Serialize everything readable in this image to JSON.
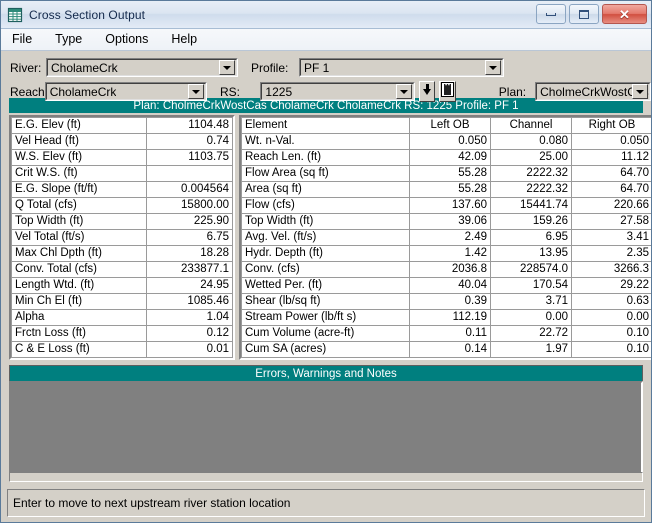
{
  "window": {
    "title": "Cross Section Output",
    "icon": "table-grid-icon",
    "minimize_label": "Minimize",
    "maximize_label": "Maximize",
    "close_label": "Close"
  },
  "menu": {
    "items": [
      {
        "label": "File"
      },
      {
        "label": "Type"
      },
      {
        "label": "Options"
      },
      {
        "label": "Help"
      }
    ]
  },
  "selectors": {
    "river_label": "River:",
    "river_value": "CholameCrk",
    "reach_label": "Reach",
    "reach_value": "CholameCrk",
    "profile_label": "Profile:",
    "profile_value": "PF 1",
    "rs_label": "RS:",
    "rs_value": "1225",
    "plan_label": "Plan:",
    "plan_value": "CholmeCrkWostCas",
    "next_rs_button": "down-arrow-button",
    "section_button": "cross-section-button"
  },
  "header_band": {
    "text": "Plan: CholmeCrkWostCas    CholameCrk    CholameCrk  RS: 1225    Profile: PF 1"
  },
  "summary_table": {
    "rows": [
      {
        "label": "E.G. Elev (ft)",
        "value": "1104.48"
      },
      {
        "label": "Vel Head (ft)",
        "value": "0.74"
      },
      {
        "label": "W.S. Elev (ft)",
        "value": "1103.75"
      },
      {
        "label": "Crit W.S. (ft)",
        "value": ""
      },
      {
        "label": "E.G. Slope (ft/ft)",
        "value": "0.004564"
      },
      {
        "label": "Q Total (cfs)",
        "value": "15800.00"
      },
      {
        "label": "Top Width (ft)",
        "value": "225.90"
      },
      {
        "label": "Vel Total (ft/s)",
        "value": "6.75"
      },
      {
        "label": "Max Chl Dpth (ft)",
        "value": "18.28"
      },
      {
        "label": "Conv. Total (cfs)",
        "value": "233877.1"
      },
      {
        "label": "Length Wtd. (ft)",
        "value": "24.95"
      },
      {
        "label": "Min Ch El (ft)",
        "value": "1085.46"
      },
      {
        "label": "Alpha",
        "value": "1.04"
      },
      {
        "label": "Frctn Loss (ft)",
        "value": "0.12"
      },
      {
        "label": "C & E Loss (ft)",
        "value": "0.01"
      }
    ]
  },
  "element_table": {
    "headers": [
      "Element",
      "Left OB",
      "Channel",
      "Right OB"
    ],
    "rows": [
      {
        "label": "Wt. n-Val.",
        "left": "0.050",
        "channel": "0.080",
        "right": "0.050"
      },
      {
        "label": "Reach Len. (ft)",
        "left": "42.09",
        "channel": "25.00",
        "right": "11.12"
      },
      {
        "label": "Flow Area (sq ft)",
        "left": "55.28",
        "channel": "2222.32",
        "right": "64.70"
      },
      {
        "label": "Area (sq ft)",
        "left": "55.28",
        "channel": "2222.32",
        "right": "64.70"
      },
      {
        "label": "Flow (cfs)",
        "left": "137.60",
        "channel": "15441.74",
        "right": "220.66"
      },
      {
        "label": "Top Width (ft)",
        "left": "39.06",
        "channel": "159.26",
        "right": "27.58"
      },
      {
        "label": "Avg. Vel. (ft/s)",
        "left": "2.49",
        "channel": "6.95",
        "right": "3.41"
      },
      {
        "label": "Hydr. Depth (ft)",
        "left": "1.42",
        "channel": "13.95",
        "right": "2.35"
      },
      {
        "label": "Conv. (cfs)",
        "left": "2036.8",
        "channel": "228574.0",
        "right": "3266.3"
      },
      {
        "label": "Wetted Per. (ft)",
        "left": "40.04",
        "channel": "170.54",
        "right": "29.22"
      },
      {
        "label": "Shear (lb/sq ft)",
        "left": "0.39",
        "channel": "3.71",
        "right": "0.63"
      },
      {
        "label": "Stream Power (lb/ft s)",
        "left": "112.19",
        "channel": "0.00",
        "right": "0.00"
      },
      {
        "label": "Cum Volume (acre-ft)",
        "left": "0.11",
        "channel": "22.72",
        "right": "0.10"
      },
      {
        "label": "Cum SA (acres)",
        "left": "0.14",
        "channel": "1.97",
        "right": "0.10"
      }
    ]
  },
  "errors_panel": {
    "title": "Errors, Warnings and Notes",
    "content": ""
  },
  "status_bar": {
    "text": "Enter to move to next upstream river station location"
  },
  "colors": {
    "teal": "#007f7f",
    "window_face": "#d4d0c8",
    "panel_gray": "#808080"
  }
}
